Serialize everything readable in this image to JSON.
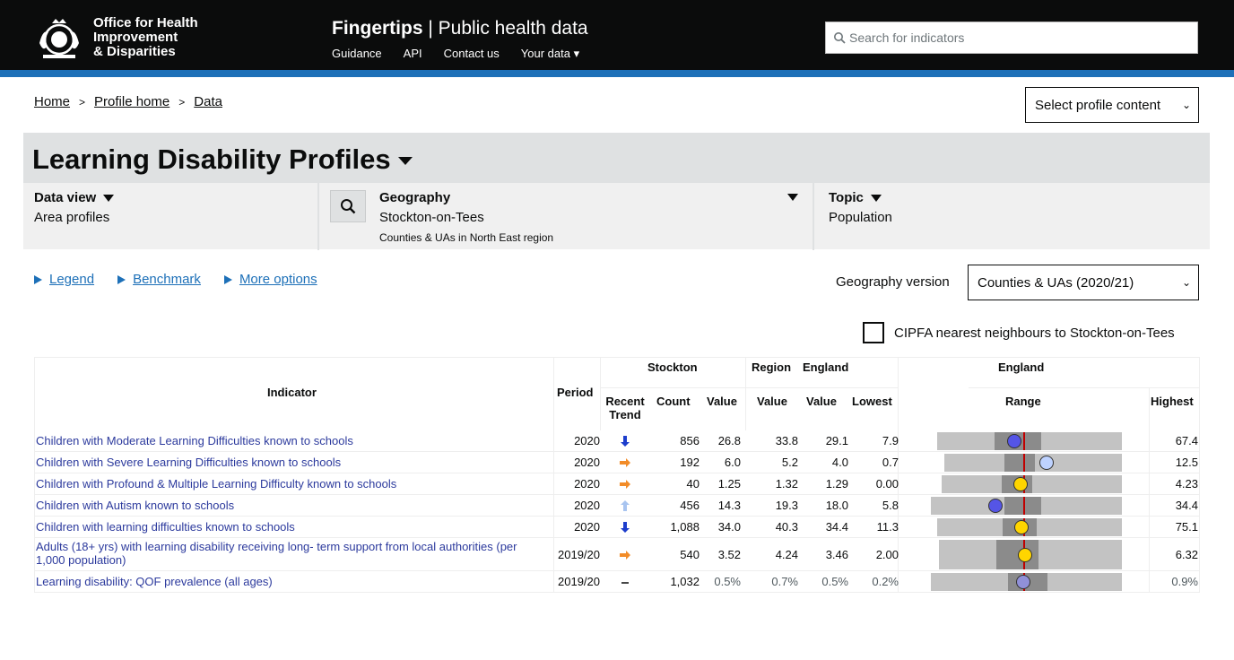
{
  "header": {
    "org_name_line1": "Office for Health",
    "org_name_line2": "Improvement",
    "org_name_line3": "& Disparities",
    "brand_bold": "Fingertips",
    "brand_rest": "| Public health data",
    "nav": [
      "Guidance",
      "API",
      "Contact us",
      "Your data ▾"
    ],
    "search_placeholder": "Search for indicators"
  },
  "breadcrumb": [
    "Home",
    "Profile home",
    "Data"
  ],
  "breadcrumb_sep": ">",
  "select_profile": "Select profile content",
  "profile_title": "Learning Disability Profiles",
  "data_view": {
    "label": "Data view",
    "value": "Area profiles"
  },
  "geography": {
    "label": "Geography",
    "value": "Stockton-on-Tees",
    "sub": "Counties & UAs in North East region"
  },
  "topic": {
    "label": "Topic",
    "value": "Population"
  },
  "options": [
    "Legend",
    "Benchmark",
    "More options"
  ],
  "geography_version_label": "Geography version",
  "geography_version_value": "Counties & UAs (2020/21)",
  "cipfa_label": "CIPFA nearest neighbours to Stockton-on-Tees",
  "table": {
    "headers": {
      "indicator": "Indicator",
      "period": "Period",
      "stockton": "Stockton",
      "region": "Region",
      "england_top": "England",
      "england_group": "England",
      "recent_trend": "Recent Trend",
      "count": "Count",
      "value": "Value",
      "lowest": "Lowest",
      "range": "Range",
      "highest": "Highest"
    },
    "rows": [
      {
        "indicator": "Children with Moderate Learning Difficulties known to schools",
        "period": "2020",
        "trend": "down-blue",
        "count": "856",
        "value": "26.8",
        "region": "33.8",
        "england": "29.1",
        "lowest": "7.9",
        "highest": "67.4",
        "marker": "blue",
        "range_min": 7.9,
        "range_max": 67.4,
        "q1": 22.0,
        "q3": 36.0,
        "england_val": 29.1,
        "area_val": 26.8
      },
      {
        "indicator": "Children with Severe Learning Difficulties known to schools",
        "period": "2020",
        "trend": "right-orange",
        "count": "192",
        "value": "6.0",
        "region": "5.2",
        "england": "4.0",
        "lowest": "0.7",
        "highest": "12.5",
        "marker": "lightblue",
        "range_min": 0.7,
        "range_max": 12.5,
        "q1": 3.2,
        "q3": 5.0,
        "england_val": 4.0,
        "area_val": 6.0
      },
      {
        "indicator": "Children with Profound & Multiple Learning Difficulty known to schools",
        "period": "2020",
        "trend": "right-orange",
        "count": "40",
        "value": "1.25",
        "region": "1.32",
        "england": "1.29",
        "lowest": "0.00",
        "highest": "4.23",
        "marker": "yellow",
        "range_min": 0.0,
        "range_max": 4.23,
        "q1": 0.95,
        "q3": 1.55,
        "england_val": 1.29,
        "area_val": 1.25
      },
      {
        "indicator": "Children with Autism known to schools",
        "period": "2020",
        "trend": "up-lightblue",
        "count": "456",
        "value": "14.3",
        "region": "19.3",
        "england": "18.0",
        "lowest": "5.8",
        "highest": "34.4",
        "marker": "blue",
        "range_min": 5.8,
        "range_max": 34.4,
        "q1": 15.5,
        "q3": 21.0,
        "england_val": 18.0,
        "area_val": 14.3
      },
      {
        "indicator": "Children with learning difficulties known to schools",
        "period": "2020",
        "trend": "down-blue",
        "count": "1,088",
        "value": "34.0",
        "region": "40.3",
        "england": "34.4",
        "lowest": "11.3",
        "highest": "75.1",
        "marker": "yellow",
        "range_min": 11.3,
        "range_max": 75.1,
        "q1": 29.0,
        "q3": 40.0,
        "england_val": 34.4,
        "area_val": 34.0
      },
      {
        "indicator": "Adults (18+ yrs) with learning disability receiving long- term support from local authorities (per 1,000 population)",
        "period": "2019/20",
        "trend": "right-orange",
        "count": "540",
        "value": "3.52",
        "region": "4.24",
        "england": "3.46",
        "lowest": "2.00",
        "highest": "6.32",
        "marker": "yellow",
        "range_min": 2.0,
        "range_max": 6.32,
        "q1": 3.0,
        "q3": 3.9,
        "england_val": 3.46,
        "area_val": 3.52
      },
      {
        "indicator": "Learning disability: QOF prevalence (all ages)",
        "period": "2019/20",
        "trend": "dash",
        "count": "1,032",
        "value": "0.5%",
        "region": "0.7%",
        "england": "0.5%",
        "lowest": "0.2%",
        "highest": "0.9%",
        "marker": "lavender",
        "range_min": 0.2,
        "range_max": 0.9,
        "q1": 0.45,
        "q3": 0.6,
        "england_val": 0.5,
        "area_val": 0.5
      }
    ]
  },
  "colors": {
    "header_bg": "#0b0c0c",
    "accent_blue": "#1d70b8",
    "link_indicator": "#2c3a9d",
    "marker_blue": "#5555e6",
    "marker_lightblue": "#bed2ff",
    "marker_yellow": "#ffd500",
    "marker_lavender": "#9090d8",
    "trend_orange": "#f28c28",
    "trend_blue": "#1d3dcc",
    "trend_lightblue": "#a8c4f0",
    "range_outer": "#c3c3c3",
    "range_inner": "#8b8b8b",
    "england_line": "#c00000"
  }
}
